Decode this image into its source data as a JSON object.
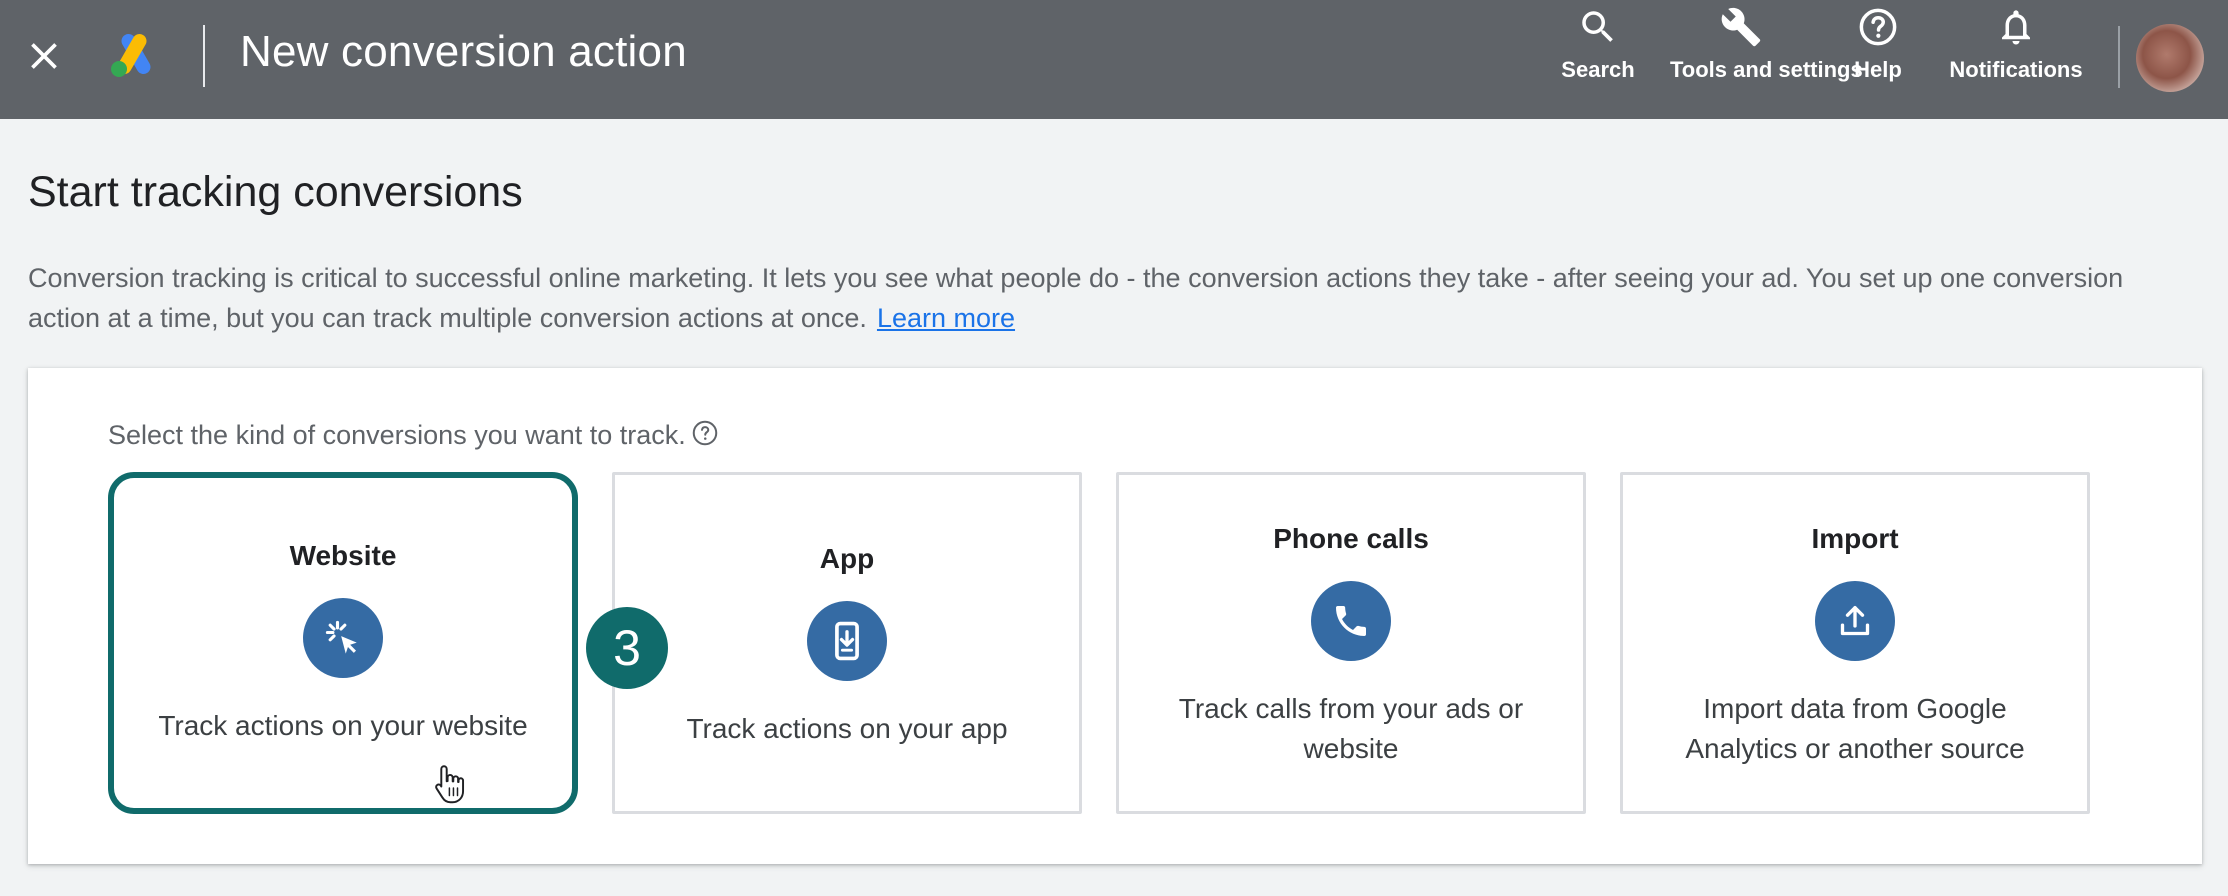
{
  "topbar": {
    "title": "New conversion action",
    "actions": [
      {
        "label": "Search",
        "icon": "search-icon"
      },
      {
        "label": "Tools and settings",
        "icon": "wrench-icon"
      },
      {
        "label": "Help",
        "icon": "help-icon"
      },
      {
        "label": "Notifications",
        "icon": "bell-icon"
      }
    ],
    "colors": {
      "bar": "#5f6368"
    }
  },
  "main": {
    "heading": "Start tracking conversions",
    "intro": "Conversion tracking is critical to successful online marketing. It lets you see what people do - the conversion actions they take - after seeing your ad. You set up one conversion action at a time, but you can track multiple conversion actions at once.",
    "learn_more": "Learn more"
  },
  "panel": {
    "prompt": "Select the kind of conversions you want to track.",
    "options": [
      {
        "title": "Website",
        "description": "Track actions on your website",
        "icon": "cursor-click-icon",
        "selected": true
      },
      {
        "title": "App",
        "description": "Track actions on your app",
        "icon": "phone-download-icon",
        "selected": false
      },
      {
        "title": "Phone calls",
        "description": "Track calls from your ads or website",
        "icon": "phone-call-icon",
        "selected": false
      },
      {
        "title": "Import",
        "description": "Import data from Google Analytics or another source",
        "icon": "upload-icon",
        "selected": false
      }
    ],
    "colors": {
      "selected_border": "#106b6b",
      "icon_bg": "#356ba4"
    }
  },
  "annotation": {
    "step": "3"
  }
}
